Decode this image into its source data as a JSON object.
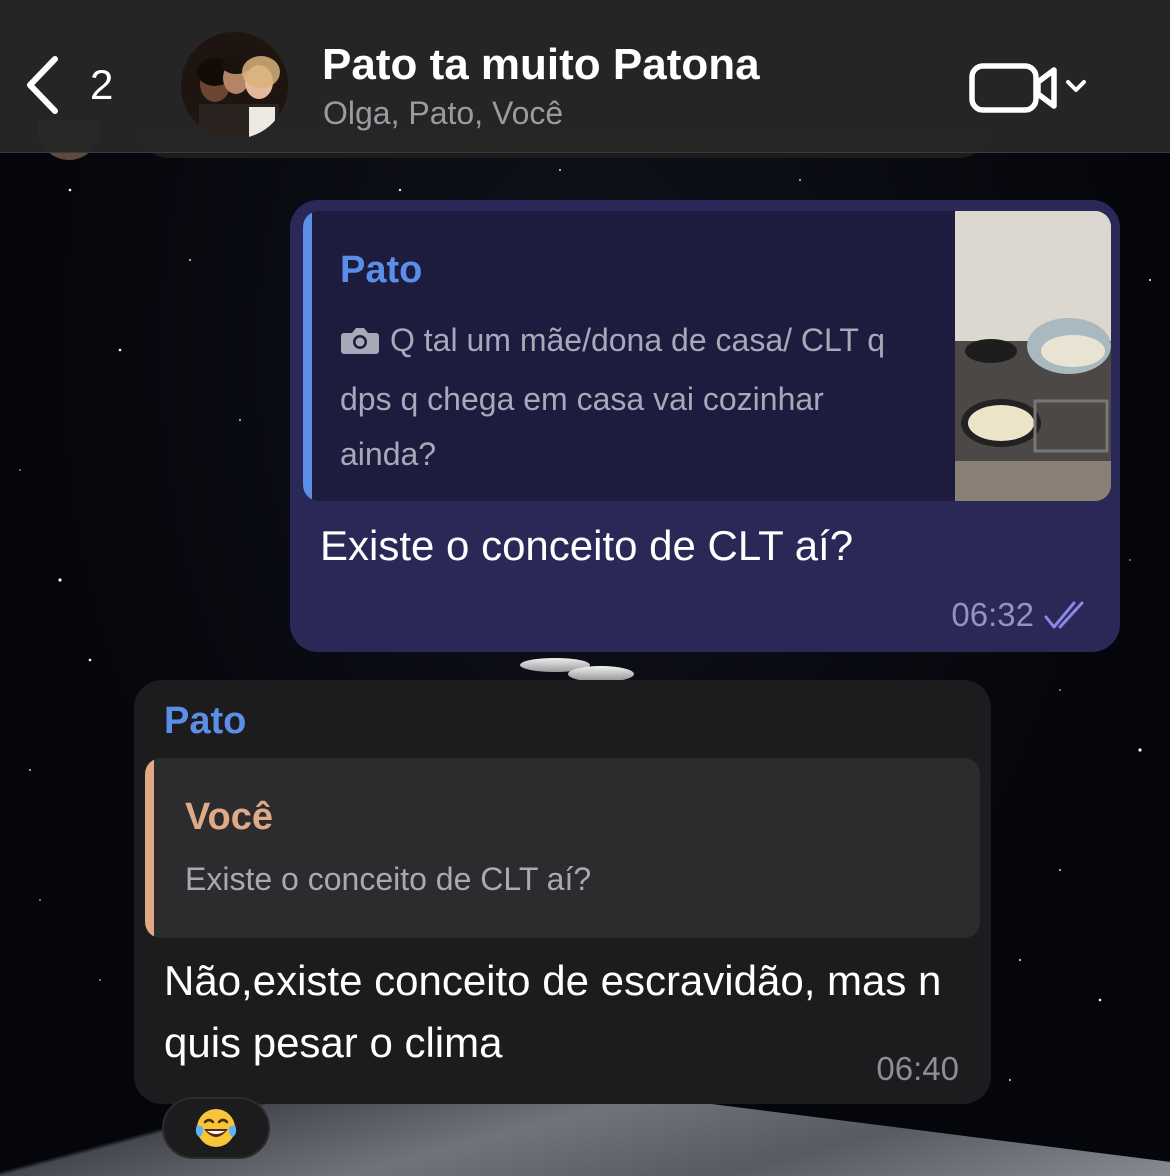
{
  "header": {
    "back_count": "2",
    "title": "Pato ta muito Patona",
    "subtitle": "Olga, Pato, Você"
  },
  "outgoing_message": {
    "quote": {
      "author": "Pato",
      "text": "Q tal um mãe/dona de casa/ CLT q dps q chega em casa vai cozinhar ainda?",
      "icon": "camera-icon"
    },
    "text": "Existe o conceito de CLT aí?",
    "time": "06:32",
    "status": "read"
  },
  "incoming_message": {
    "sender": "Pato",
    "quote": {
      "author": "Você",
      "text": "Existe o conceito de CLT aí?"
    },
    "text": "Não,existe conceito de escravidão, mas n  quis pesar o clima",
    "time": "06:40",
    "reaction": "😂"
  },
  "colors": {
    "header_bg": "#262628",
    "outgoing_bubble": "#2a2857",
    "outgoing_quote_bg": "#1d1c3f",
    "incoming_bubble": "#1c1c1e",
    "incoming_quote_bg": "#2c2c2e",
    "link_blue": "#5b8ee6",
    "quote_you": "#e0a988",
    "read_ticks": "#8d86e6"
  }
}
